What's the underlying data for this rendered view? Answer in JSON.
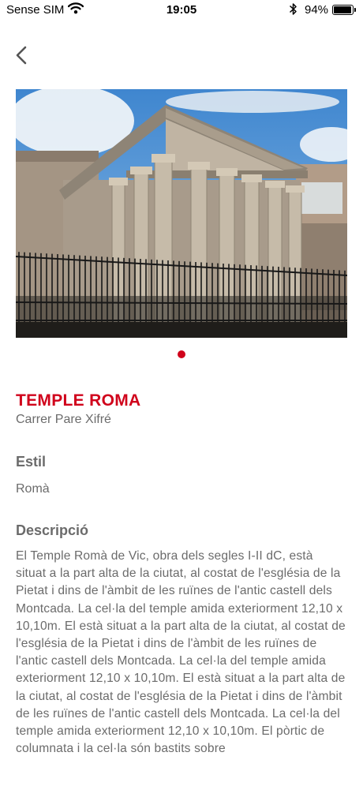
{
  "status_bar": {
    "carrier": "Sense SIM",
    "time": "19:05",
    "battery": "94%",
    "battery_level": 0.94
  },
  "header": {
    "back_icon": "chevron-left-icon"
  },
  "gallery": {
    "image": "Roman temple with columns and pediment behind an iron fence",
    "page_count": 1,
    "active_page": 1,
    "indicator_color": "#d0021b"
  },
  "monument": {
    "title": "TEMPLE ROMA",
    "address": "Carrer Pare Xifré",
    "style_heading": "Estil",
    "style_value": "Romà",
    "description_heading": "Descripció",
    "description": "El Temple Romà de Vic, obra dels segles I-II dC, està situat a la part alta de la ciutat, al costat de l'església de la Pietat i dins de l'àmbit de les ruïnes de l'antic castell dels Montcada. La cel·la del temple amida exteriorment 12,10 x 10,10m. El està situat a la part alta de la ciutat, al costat de l'església de la Pietat i dins de l'àmbit de les ruïnes de l'antic castell dels Montcada. La cel·la del temple amida exteriorment 12,10 x 10,10m. El està situat a la part alta de la ciutat, al costat de l'església de la Pietat i dins de l'àmbit de les ruïnes de l'antic castell dels Montcada. La cel·la del temple amida exteriorment 12,10 x 10,10m. El pòrtic de columnata i la cel·la són bastits sobre"
  },
  "colors": {
    "accent": "#d0021b",
    "text_gray": "#6b6b6b"
  }
}
